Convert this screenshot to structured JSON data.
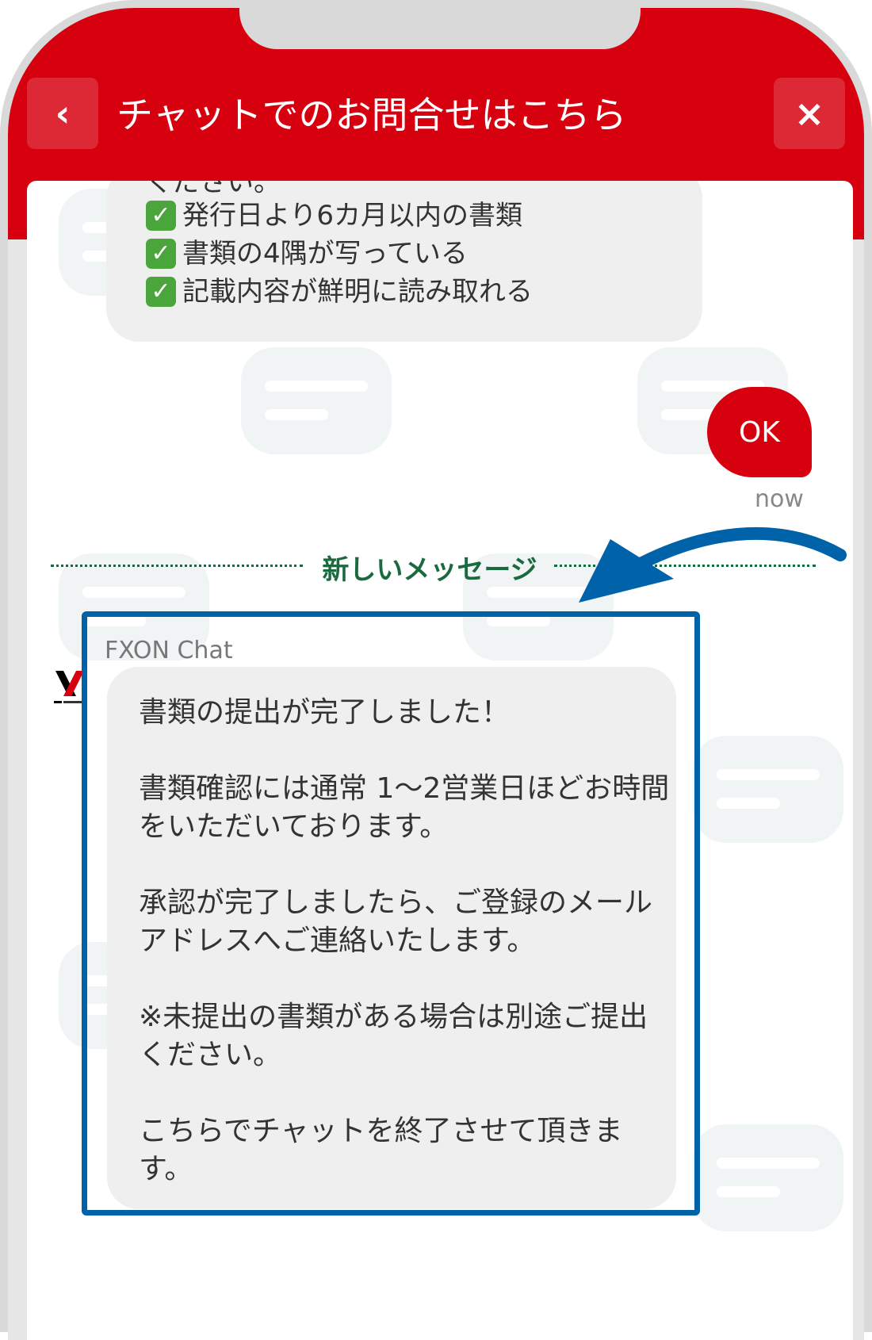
{
  "header": {
    "title": "チャットでのお問合せはこちら",
    "back_icon": "chevron-left-icon",
    "close_icon": "close-icon",
    "back_glyph": "‹",
    "close_glyph": "×",
    "accent_color": "#d7000f"
  },
  "previous_message": {
    "cut_line": "ください。",
    "checklist": [
      "発行日より6カ月以内の書類",
      "書類の4隅が写っている",
      "記載内容が鮮明に読み取れる"
    ],
    "check_glyph": "✓"
  },
  "user_message": {
    "text": "OK",
    "time": "now"
  },
  "divider": {
    "label": "新しいメッセージ",
    "color": "#1a6a40"
  },
  "bot_message": {
    "sender": "FXON Chat",
    "paragraphs": [
      "書類の提出が完了しました！",
      "書類確認には通常 1〜2営業日ほどお時間をいただいております。",
      "承認が完了しましたら、ご登録のメールアドレスへご連絡いたします。",
      "※未提出の書類がある場合は別途ご提出ください。",
      "こちらでチャットを終了させて頂きます。"
    ]
  },
  "annotation": {
    "highlight_color": "#0062a8"
  }
}
